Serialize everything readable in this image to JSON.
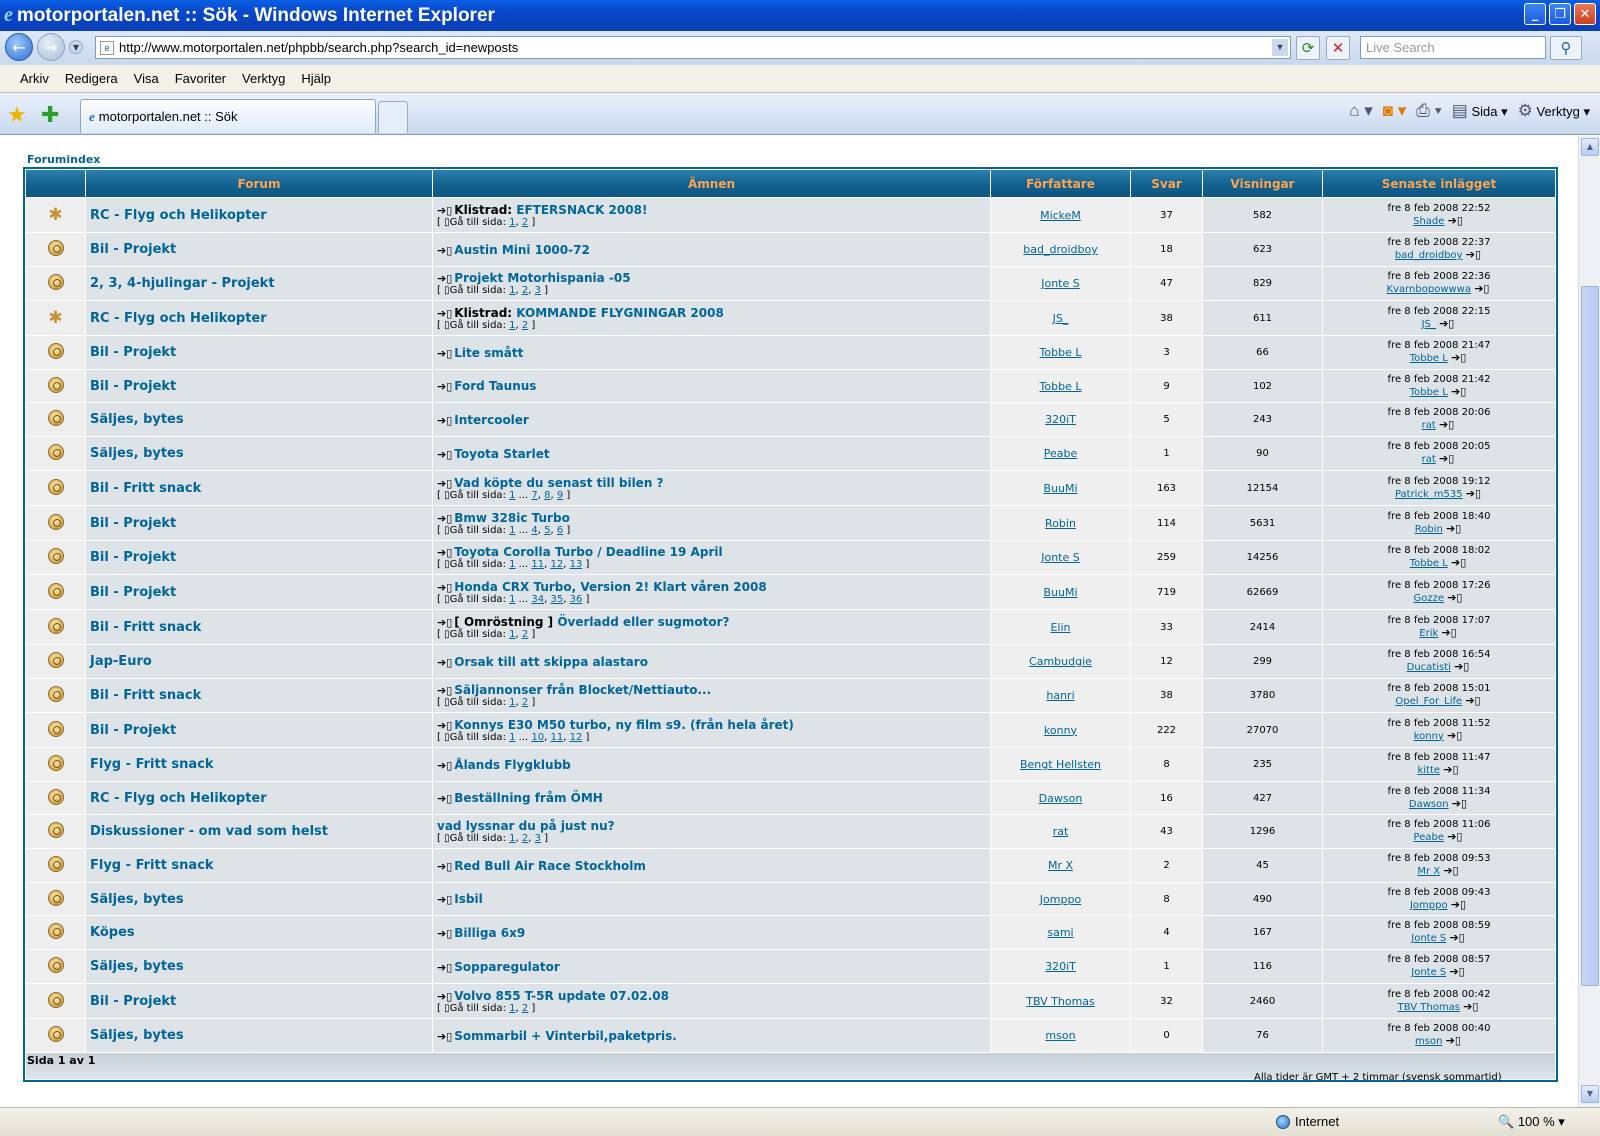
{
  "window": {
    "title": "motorportalen.net :: Sök - Windows Internet Explorer",
    "url": "http://www.motorportalen.net/phpbb/search.php?search_id=newposts",
    "search_placeholder": "Live Search",
    "tab_title": "motorportalen.net :: Sök"
  },
  "menu": [
    "Arkiv",
    "Redigera",
    "Visa",
    "Favoriter",
    "Verktyg",
    "Hjälp"
  ],
  "commandbar": {
    "page_label": "Sida",
    "tools_label": "Verktyg"
  },
  "breadcrumb": "Forumindex",
  "headers": {
    "forum": "Forum",
    "topics": "Ämnen",
    "author": "Författare",
    "replies": "Svar",
    "views": "Visningar",
    "last_post": "Senaste inlägget"
  },
  "goto_label": "Gå till sida:",
  "rows": [
    {
      "sticky": true,
      "forum": "RC - Flyg och Helikopter",
      "prefix": "Klistrad:",
      "topic": "EFTERSNACK 2008!",
      "pages": "1, 2",
      "author": "MickeM",
      "replies": "37",
      "views": "582",
      "date": "fre 8 feb 2008 22:52",
      "lastuser": "Shade"
    },
    {
      "sticky": false,
      "forum": "Bil - Projekt",
      "prefix": "",
      "topic": "Austin Mini 1000-72",
      "pages": "",
      "author": "bad_droidboy",
      "replies": "18",
      "views": "623",
      "date": "fre 8 feb 2008 22:37",
      "lastuser": "bad_droidboy"
    },
    {
      "sticky": false,
      "forum": "2, 3, 4-hjulingar - Projekt",
      "prefix": "",
      "topic": "Projekt Motorhispania -05",
      "pages": "1, 2, 3",
      "author": "Jonte S",
      "replies": "47",
      "views": "829",
      "date": "fre 8 feb 2008 22:36",
      "lastuser": "Kvarnbopowwwa"
    },
    {
      "sticky": true,
      "forum": "RC - Flyg och Helikopter",
      "prefix": "Klistrad:",
      "topic": "KOMMANDE FLYGNINGAR 2008",
      "pages": "1, 2",
      "author": "JS_",
      "replies": "38",
      "views": "611",
      "date": "fre 8 feb 2008 22:15",
      "lastuser": "JS_"
    },
    {
      "sticky": false,
      "forum": "Bil - Projekt",
      "prefix": "",
      "topic": "Lite smått",
      "pages": "",
      "author": "Tobbe L",
      "replies": "3",
      "views": "66",
      "date": "fre 8 feb 2008 21:47",
      "lastuser": "Tobbe L"
    },
    {
      "sticky": false,
      "forum": "Bil - Projekt",
      "prefix": "",
      "topic": "Ford Taunus",
      "pages": "",
      "author": "Tobbe L",
      "replies": "9",
      "views": "102",
      "date": "fre 8 feb 2008 21:42",
      "lastuser": "Tobbe L"
    },
    {
      "sticky": false,
      "forum": "Säljes, bytes",
      "prefix": "",
      "topic": "Intercooler",
      "pages": "",
      "author": "320iT",
      "replies": "5",
      "views": "243",
      "date": "fre 8 feb 2008 20:06",
      "lastuser": "rat"
    },
    {
      "sticky": false,
      "forum": "Säljes, bytes",
      "prefix": "",
      "topic": "Toyota Starlet",
      "pages": "",
      "author": "Peabe",
      "replies": "1",
      "views": "90",
      "date": "fre 8 feb 2008 20:05",
      "lastuser": "rat"
    },
    {
      "sticky": false,
      "forum": "Bil - Fritt snack",
      "prefix": "",
      "topic": "Vad köpte du senast till bilen ?",
      "pages": "1 ... 7, 8, 9",
      "author": "BuuMi",
      "replies": "163",
      "views": "12154",
      "date": "fre 8 feb 2008 19:12",
      "lastuser": "Patrick_m535"
    },
    {
      "sticky": false,
      "forum": "Bil - Projekt",
      "prefix": "",
      "topic": "Bmw 328ic Turbo",
      "pages": "1 ... 4, 5, 6",
      "author": "Robin",
      "replies": "114",
      "views": "5631",
      "date": "fre 8 feb 2008 18:40",
      "lastuser": "Robin"
    },
    {
      "sticky": false,
      "forum": "Bil - Projekt",
      "prefix": "",
      "topic": "Toyota Corolla Turbo / Deadline 19 April",
      "pages": "1 ... 11, 12, 13",
      "author": "Jonte S",
      "replies": "259",
      "views": "14256",
      "date": "fre 8 feb 2008 18:02",
      "lastuser": "Tobbe L"
    },
    {
      "sticky": false,
      "forum": "Bil - Projekt",
      "prefix": "",
      "topic": "Honda CRX Turbo, Version 2! Klart våren 2008",
      "pages": "1 ... 34, 35, 36",
      "author": "BuuMi",
      "replies": "719",
      "views": "62669",
      "date": "fre 8 feb 2008 17:26",
      "lastuser": "Gozze"
    },
    {
      "sticky": false,
      "forum": "Bil - Fritt snack",
      "prefix": "[ Omröstning ]",
      "topic": "Överladd eller sugmotor?",
      "pages": "1, 2",
      "author": "Elin",
      "replies": "33",
      "views": "2414",
      "date": "fre 8 feb 2008 17:07",
      "lastuser": "Erik"
    },
    {
      "sticky": false,
      "forum": "Jap-Euro",
      "prefix": "",
      "topic": "Orsak till att skippa alastaro",
      "pages": "",
      "author": "Cambudgie",
      "replies": "12",
      "views": "299",
      "date": "fre 8 feb 2008 16:54",
      "lastuser": "Ducatisti"
    },
    {
      "sticky": false,
      "forum": "Bil - Fritt snack",
      "prefix": "",
      "topic": "Säljannonser från Blocket/Nettiauto...",
      "pages": "1, 2",
      "author": "hanri",
      "replies": "38",
      "views": "3780",
      "date": "fre 8 feb 2008 15:01",
      "lastuser": "Opel_For_Life"
    },
    {
      "sticky": false,
      "forum": "Bil - Projekt",
      "prefix": "",
      "topic": "Konnys E30 M50 turbo, ny film s9. (från hela året)",
      "pages": "1 ... 10, 11, 12",
      "author": "konny",
      "replies": "222",
      "views": "27070",
      "date": "fre 8 feb 2008 11:52",
      "lastuser": "konny"
    },
    {
      "sticky": false,
      "forum": "Flyg - Fritt snack",
      "prefix": "",
      "topic": "Ålands Flygklubb",
      "pages": "",
      "author": "Bengt Hellsten",
      "replies": "8",
      "views": "235",
      "date": "fre 8 feb 2008 11:47",
      "lastuser": "kitte"
    },
    {
      "sticky": false,
      "forum": "RC - Flyg och Helikopter",
      "prefix": "",
      "topic": "Beställning fråm ÖMH",
      "pages": "",
      "author": "Dawson",
      "replies": "16",
      "views": "427",
      "date": "fre 8 feb 2008 11:34",
      "lastuser": "Dawson"
    },
    {
      "sticky": false,
      "forum": "Diskussioner - om vad som helst",
      "prefix": "",
      "topic": "vad lyssnar du på just nu?",
      "pages": "1, 2, 3",
      "author": "rat",
      "replies": "43",
      "views": "1296",
      "date": "fre 8 feb 2008 11:06",
      "lastuser": "Peabe",
      "noarrow": true
    },
    {
      "sticky": false,
      "forum": "Flyg - Fritt snack",
      "prefix": "",
      "topic": "Red Bull Air Race Stockholm",
      "pages": "",
      "author": "Mr X",
      "replies": "2",
      "views": "45",
      "date": "fre 8 feb 2008 09:53",
      "lastuser": "Mr X"
    },
    {
      "sticky": false,
      "forum": "Säljes, bytes",
      "prefix": "",
      "topic": "Isbil",
      "pages": "",
      "author": "Jomppo",
      "replies": "8",
      "views": "490",
      "date": "fre 8 feb 2008 09:43",
      "lastuser": "Jomppo"
    },
    {
      "sticky": false,
      "forum": "Köpes",
      "prefix": "",
      "topic": "Billiga 6x9",
      "pages": "",
      "author": "sami",
      "replies": "4",
      "views": "167",
      "date": "fre 8 feb 2008 08:59",
      "lastuser": "Jonte S"
    },
    {
      "sticky": false,
      "forum": "Säljes, bytes",
      "prefix": "",
      "topic": "Sopparegulator",
      "pages": "",
      "author": "320iT",
      "replies": "1",
      "views": "116",
      "date": "fre 8 feb 2008 08:57",
      "lastuser": "Jonte S"
    },
    {
      "sticky": false,
      "forum": "Bil - Projekt",
      "prefix": "",
      "topic": "Volvo 855 T-5R update 07.02.08",
      "pages": "1, 2",
      "author": "TBV Thomas",
      "replies": "32",
      "views": "2460",
      "date": "fre 8 feb 2008 00:42",
      "lastuser": "TBV Thomas"
    },
    {
      "sticky": false,
      "forum": "Säljes, bytes",
      "prefix": "",
      "topic": "Sommarbil + Vinterbil,paketpris.",
      "pages": "",
      "author": "mson",
      "replies": "0",
      "views": "76",
      "date": "fre 8 feb 2008 00:40",
      "lastuser": "mson"
    }
  ],
  "pagination": "Sida 1 av 1",
  "timezone": "Alla tider är GMT + 2 timmar (svensk sommartid)",
  "status": {
    "zone": "Internet",
    "zoom": "100 %"
  }
}
